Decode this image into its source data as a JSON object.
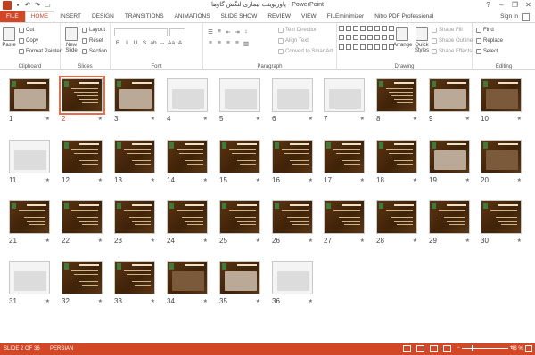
{
  "window": {
    "title": "پاورپوینت بیماری لنگش گاوها - PowerPoint",
    "help": "?",
    "minimize": "–",
    "restore": "❐",
    "close": "✕"
  },
  "ribbon_tabs": [
    "FILE",
    "HOME",
    "INSERT",
    "DESIGN",
    "TRANSITIONS",
    "ANIMATIONS",
    "SLIDE SHOW",
    "REVIEW",
    "VIEW",
    "FILEminimizer",
    "Nitro PDF Professional"
  ],
  "active_tab": "HOME",
  "signin": "Sign in",
  "ribbon": {
    "clipboard": {
      "label": "Clipboard",
      "paste": "Paste",
      "cut": "Cut",
      "copy": "Copy",
      "format_painter": "Format Painter"
    },
    "slides": {
      "label": "Slides",
      "new_slide": "New Slide",
      "layout": "Layout",
      "reset": "Reset",
      "section": "Section"
    },
    "font": {
      "label": "Font"
    },
    "paragraph": {
      "label": "Paragraph",
      "text_direction": "Text Direction",
      "align_text": "Align Text",
      "convert_smartart": "Convert to SmartArt"
    },
    "drawing": {
      "label": "Drawing",
      "arrange": "Arrange",
      "quick_styles": "Quick Styles",
      "shape_fill": "Shape Fill",
      "shape_outline": "Shape Outline",
      "shape_effects": "Shape Effects"
    },
    "editing": {
      "label": "Editing",
      "find": "Find",
      "replace": "Replace",
      "select": "Select"
    }
  },
  "slides": [
    {
      "n": "1",
      "style": "photo"
    },
    {
      "n": "2",
      "style": "text"
    },
    {
      "n": "3",
      "style": "photo"
    },
    {
      "n": "4",
      "style": "light"
    },
    {
      "n": "5",
      "style": "light"
    },
    {
      "n": "6",
      "style": "light"
    },
    {
      "n": "7",
      "style": "light"
    },
    {
      "n": "8",
      "style": "text"
    },
    {
      "n": "9",
      "style": "photo"
    },
    {
      "n": "10",
      "style": "photo"
    },
    {
      "n": "11",
      "style": "light"
    },
    {
      "n": "12",
      "style": "text"
    },
    {
      "n": "13",
      "style": "text"
    },
    {
      "n": "14",
      "style": "text"
    },
    {
      "n": "15",
      "style": "text"
    },
    {
      "n": "16",
      "style": "text"
    },
    {
      "n": "17",
      "style": "text"
    },
    {
      "n": "18",
      "style": "text"
    },
    {
      "n": "19",
      "style": "photo"
    },
    {
      "n": "20",
      "style": "photo"
    },
    {
      "n": "21",
      "style": "text"
    },
    {
      "n": "22",
      "style": "text"
    },
    {
      "n": "23",
      "style": "text"
    },
    {
      "n": "24",
      "style": "text"
    },
    {
      "n": "25",
      "style": "text"
    },
    {
      "n": "26",
      "style": "text"
    },
    {
      "n": "27",
      "style": "text"
    },
    {
      "n": "28",
      "style": "text"
    },
    {
      "n": "29",
      "style": "text"
    },
    {
      "n": "30",
      "style": "text"
    },
    {
      "n": "31",
      "style": "light"
    },
    {
      "n": "32",
      "style": "text"
    },
    {
      "n": "33",
      "style": "text"
    },
    {
      "n": "34",
      "style": "photo"
    },
    {
      "n": "35",
      "style": "photo"
    },
    {
      "n": "36",
      "style": "light"
    }
  ],
  "selected_slide": "2",
  "star_glyph": "★",
  "status": {
    "slide_of": "SLIDE 2 OF 36",
    "language": "PERSIAN",
    "zoom": "48 %",
    "zoom_level_pct": 48
  },
  "colors": {
    "accent": "#d24726",
    "slide_bg": "#4a2a0c"
  }
}
